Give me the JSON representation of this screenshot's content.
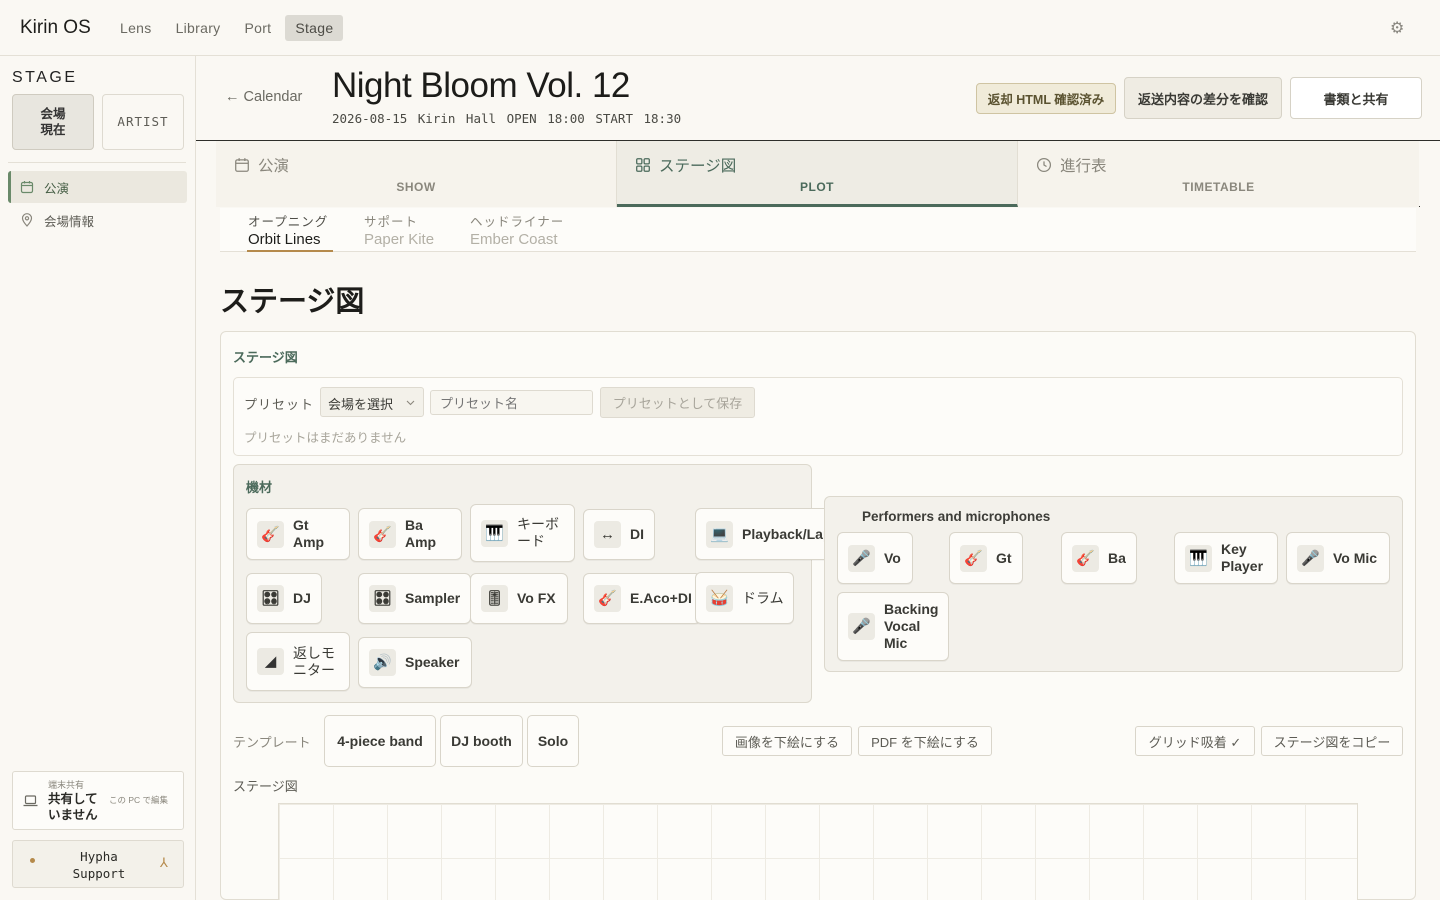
{
  "app": {
    "name": "Kirin OS"
  },
  "nav": [
    {
      "label": "Lens"
    },
    {
      "label": "Library"
    },
    {
      "label": "Port"
    },
    {
      "label": "Stage"
    }
  ],
  "sidebar": {
    "title": "STAGE",
    "mode_venue": {
      "line1": "会場",
      "line2": "現在"
    },
    "mode_artist": "ARTIST",
    "items": [
      {
        "label": "公演"
      },
      {
        "label": "会場情報"
      }
    ],
    "share": {
      "small": "端末共有",
      "main_line1": "共有して",
      "main_line2": "いません",
      "note": "この PC で編集"
    },
    "support": {
      "line1": "Hypha",
      "line2": "Support",
      "arrow": "⅄"
    }
  },
  "header": {
    "back": "← Calendar",
    "title": "Night Bloom Vol. 12",
    "meta": "2026-08-15  Kirin Hall  OPEN 18:00  START 18:30",
    "badge": "返却 HTML 確認済み",
    "diff_btn": "返送内容の差分を確認",
    "share_btn": "書類と共有"
  },
  "main_tabs": [
    {
      "label": "公演",
      "sub": "SHOW"
    },
    {
      "label": "ステージ図",
      "sub": "PLOT"
    },
    {
      "label": "進行表",
      "sub": "TIMETABLE"
    }
  ],
  "acts": [
    {
      "role": "オープニング",
      "name": "Orbit Lines"
    },
    {
      "role": "サポート",
      "name": "Paper Kite"
    },
    {
      "role": "ヘッドライナー",
      "name": "Ember Coast"
    }
  ],
  "section_title": "ステージ図",
  "card": {
    "label": "ステージ図",
    "preset_label": "プリセット",
    "preset_select": "会場を選択",
    "preset_placeholder": "プリセット名",
    "preset_save": "プリセットとして保存",
    "preset_empty": "プリセットはまだありません"
  },
  "equipment": {
    "title": "機材",
    "items": [
      {
        "label": "Gt Amp",
        "icon": "guitar-icon"
      },
      {
        "label": "Ba Amp",
        "icon": "guitar-icon"
      },
      {
        "label": "キーボード",
        "icon": "keyboard-icon"
      },
      {
        "label": "DI",
        "icon": "di-icon"
      },
      {
        "label": "Playback/Laptop",
        "icon": "laptop-icon"
      },
      {
        "label": "DJ",
        "icon": "dj-icon"
      },
      {
        "label": "Sampler",
        "icon": "sampler-icon"
      },
      {
        "label": "Vo FX",
        "icon": "fx-icon"
      },
      {
        "label": "E.Aco+DI",
        "icon": "guitar-icon"
      },
      {
        "label": "ドラム",
        "icon": "drum-icon"
      },
      {
        "label": "返しモニター",
        "icon": "monitor-icon"
      },
      {
        "label": "Speaker",
        "icon": "speaker-icon"
      }
    ]
  },
  "performers": {
    "title": "Performers and microphones",
    "items": [
      {
        "label": "Vo",
        "icon": "mic-icon"
      },
      {
        "label": "Gt",
        "icon": "guitar-icon"
      },
      {
        "label": "Ba",
        "icon": "guitar-icon"
      },
      {
        "label": "Key Player",
        "icon": "keyboard-icon"
      },
      {
        "label": "Vo Mic",
        "icon": "mic-icon"
      },
      {
        "label": "Backing Vocal Mic",
        "icon": "mic-icon"
      }
    ]
  },
  "templates": {
    "label": "テンプレート",
    "items": [
      "4-piece band",
      "DJ booth",
      "Solo"
    ]
  },
  "tools": {
    "image_base": "画像を下絵にする",
    "pdf_base": "PDF を下絵にする",
    "grid_snap": "グリッド吸着 ✓",
    "copy_plot": "ステージ図をコピー"
  },
  "plot_label": "ステージ図",
  "colors": {
    "accent": "#4b6a5b",
    "underline": "#b58a4b",
    "background": "#faf8f3"
  }
}
